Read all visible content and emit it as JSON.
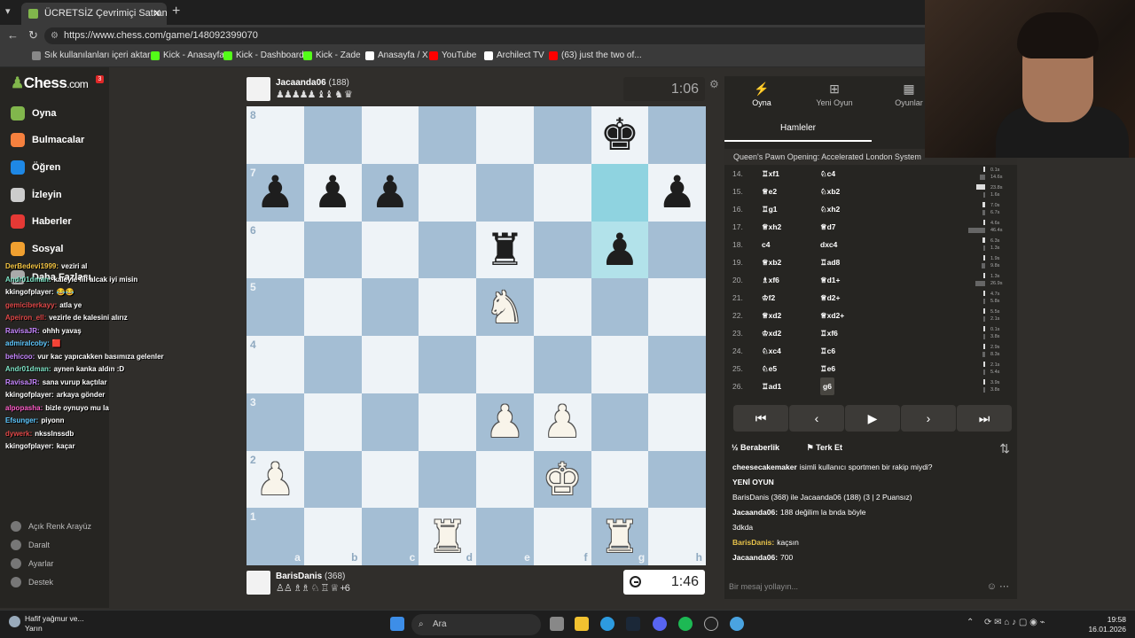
{
  "browser": {
    "tab_title": "ÜCRETSİZ Çevrimiçi Satranç Oyna",
    "url": "https://www.chess.com/game/148092399070",
    "bookmarks": [
      {
        "label": "Sık kullanılanları içeri aktar",
        "color": "#888888"
      },
      {
        "label": "Kick - Anasayfa",
        "color": "#53fc18"
      },
      {
        "label": "Kick - Dashboard",
        "color": "#53fc18"
      },
      {
        "label": "Kick - Zade",
        "color": "#53fc18"
      },
      {
        "label": "Anasayfa / X",
        "color": "#ffffff"
      },
      {
        "label": "YouTube",
        "color": "#ff0000"
      },
      {
        "label": "Archilect TV",
        "color": "#ffffff"
      },
      {
        "label": "(63) just the two of...",
        "color": "#ff0000"
      }
    ]
  },
  "sidebar": {
    "logo": "Chess",
    "logo_suffix": ".com",
    "badge": "3",
    "items": [
      {
        "label": "Oyna",
        "color": "#81b64c"
      },
      {
        "label": "Bulmacalar",
        "color": "#f5803e"
      },
      {
        "label": "Öğren",
        "color": "#1e88e5"
      },
      {
        "label": "İzleyin",
        "color": "#cccccc"
      },
      {
        "label": "Haberler",
        "color": "#e53935"
      },
      {
        "label": "Sosyal",
        "color": "#f0a030"
      },
      {
        "label": "Daha Fazlası",
        "color": "#aaaaaa"
      }
    ],
    "bottom": [
      "Açık Renk Arayüz",
      "Daralt",
      "Ayarlar",
      "Destek"
    ]
  },
  "stream_chat": [
    {
      "user": "DerBedevi1999:",
      "text": "veziri al",
      "color": "#f5c542"
    },
    {
      "user": "Andr01dman:",
      "text": "kaleyle fili alcak iyi misin",
      "color": "#7de3c5"
    },
    {
      "user": "kkingofplayer:",
      "text": "😂😂",
      "color": "#ffffff"
    },
    {
      "user": "gemiciberkayy:",
      "text": "atla ye",
      "color": "#e04848"
    },
    {
      "user": "Apeiron_ell:",
      "text": "vezirle de kalesini alırız",
      "color": "#e04848"
    },
    {
      "user": "RavisaJR:",
      "text": "ohhh yavaş",
      "color": "#c685ff"
    },
    {
      "user": "admiralcoby:",
      "text": "🟥",
      "color": "#5ec8ff"
    },
    {
      "user": "behicoo:",
      "text": "vur kac yapıcakken basımıza gelenler",
      "color": "#c685ff"
    },
    {
      "user": "Andr01dman:",
      "text": "aynen kanka aldın :D",
      "color": "#7de3c5"
    },
    {
      "user": "RavisaJR:",
      "text": "sana vurup kaçtılar",
      "color": "#c685ff"
    },
    {
      "user": "kkingofplayer:",
      "text": "arkaya gönder",
      "color": "#ffffff"
    },
    {
      "user": "alpopasha:",
      "text": "bizle oynuyo mu la",
      "color": "#ff5cc8"
    },
    {
      "user": "Efsunger:",
      "text": "piyonn",
      "color": "#5ec8ff"
    },
    {
      "user": "dywerk:",
      "text": "nkssInssdb",
      "color": "#e04848"
    },
    {
      "user": "kkingofplayer:",
      "text": "kaçar",
      "color": "#ffffff"
    }
  ],
  "top_player": {
    "name": "Jacaanda06",
    "rating": "(188)",
    "captures": "♟♟♟♟♟ ♝♝ ♞ ♛",
    "clock": "1:06"
  },
  "bottom_player": {
    "name": "BarisDanis",
    "rating": "(368)",
    "captures": "♙♙ ♗♗ ♘ ♖ ♕",
    "advantage": "+6",
    "clock": "1:46"
  },
  "board": {
    "files": [
      "a",
      "b",
      "c",
      "d",
      "e",
      "f",
      "g",
      "h"
    ],
    "ranks": [
      "8",
      "7",
      "6",
      "5",
      "4",
      "3",
      "2",
      "1"
    ],
    "pieces": [
      {
        "sq": "g8",
        "p": "♚",
        "side": "b"
      },
      {
        "sq": "a7",
        "p": "♟",
        "side": "b"
      },
      {
        "sq": "b7",
        "p": "♟",
        "side": "b"
      },
      {
        "sq": "c7",
        "p": "♟",
        "side": "b"
      },
      {
        "sq": "h7",
        "p": "♟",
        "side": "b"
      },
      {
        "sq": "e6",
        "p": "♜",
        "side": "b"
      },
      {
        "sq": "g6",
        "p": "♟",
        "side": "b"
      },
      {
        "sq": "e5",
        "p": "♞",
        "side": "w"
      },
      {
        "sq": "e3",
        "p": "♟",
        "side": "w"
      },
      {
        "sq": "f3",
        "p": "♟",
        "side": "w"
      },
      {
        "sq": "a2",
        "p": "♟",
        "side": "w"
      },
      {
        "sq": "f2",
        "p": "♚",
        "side": "w"
      },
      {
        "sq": "d1",
        "p": "♜",
        "side": "w"
      },
      {
        "sq": "g1",
        "p": "♜",
        "side": "w"
      }
    ],
    "highlight_from": "g7",
    "highlight_to": "g6"
  },
  "panel": {
    "tabs": [
      {
        "label": "Oyna",
        "icon": "⚡"
      },
      {
        "label": "Yeni Oyun",
        "icon": "⊞"
      },
      {
        "label": "Oyunlar",
        "icon": "▦"
      }
    ],
    "subtab": "Hamleler",
    "opening": "Queen's Pawn Opening: Accelerated London System",
    "moves": [
      {
        "n": "14.",
        "w": "♖xf1",
        "b": "♘c4",
        "tw": "0.1s",
        "tb": "14.6s",
        "fw": 0.02,
        "fb": 0.3
      },
      {
        "n": "15.",
        "w": "♕e2",
        "b": "♘xb2",
        "tw": "23.8s",
        "tb": "1.6s",
        "fw": 0.5,
        "fb": 0.04
      },
      {
        "n": "16.",
        "w": "♖g1",
        "b": "♘xh2",
        "tw": "7.0s",
        "tb": "6.7s",
        "fw": 0.15,
        "fb": 0.14
      },
      {
        "n": "17.",
        "w": "♕xh2",
        "b": "♕d7",
        "tw": "4.6s",
        "tb": "46.4s",
        "fw": 0.1,
        "fb": 0.95
      },
      {
        "n": "18.",
        "w": "c4",
        "b": "dxc4",
        "tw": "6.3s",
        "tb": "1.3s",
        "fw": 0.13,
        "fb": 0.03
      },
      {
        "n": "19.",
        "w": "♕xb2",
        "b": "♖ad8",
        "tw": "1.9s",
        "tb": "9.8s",
        "fw": 0.04,
        "fb": 0.2
      },
      {
        "n": "20.",
        "w": "♗xf6",
        "b": "♕d1+",
        "tw": "1.3s",
        "tb": "26.9s",
        "fw": 0.03,
        "fb": 0.55
      },
      {
        "n": "21.",
        "w": "♔f2",
        "b": "♕d2+",
        "tw": "4.7s",
        "tb": "5.8s",
        "fw": 0.1,
        "fb": 0.12
      },
      {
        "n": "22.",
        "w": "♕xd2",
        "b": "♕xd2+",
        "tw": "5.5s",
        "tb": "2.1s",
        "fw": 0.11,
        "fb": 0.04
      },
      {
        "n": "23.",
        "w": "♔xd2",
        "b": "♖xf6",
        "tw": "0.1s",
        "tb": "3.8s",
        "fw": 0.02,
        "fb": 0.08
      },
      {
        "n": "24.",
        "w": "♘xc4",
        "b": "♖c6",
        "tw": "2.9s",
        "tb": "8.3s",
        "fw": 0.06,
        "fb": 0.17
      },
      {
        "n": "25.",
        "w": "♘e5",
        "b": "♖e6",
        "tw": "2.1s",
        "tb": "5.4s",
        "fw": 0.04,
        "fb": 0.11
      },
      {
        "n": "26.",
        "w": "♖ad1",
        "b": "g6",
        "tw": "3.9s",
        "tb": "3.8s",
        "fw": 0.08,
        "fb": 0.08
      }
    ],
    "controls": [
      "⏮",
      "‹",
      "▶",
      "›",
      "⏭"
    ],
    "draw_label": "Beraberlik",
    "resign_label": "Terk Et",
    "chat": [
      {
        "user": "cheesecakemaker",
        "text": "isimli kullanıcı sportmen bir rakip miydi?"
      },
      {
        "user": "",
        "text": "YENİ OYUN"
      },
      {
        "user": "",
        "text": "BarisDanis (368) ile Jacaanda06 (188) (3 | 2 Puansız)"
      },
      {
        "user": "Jacaanda06:",
        "text": "188 değilim la bnda böyle"
      },
      {
        "user": "",
        "text": "3dkda"
      },
      {
        "user": "BarisDanis:",
        "text": "kaçsın"
      },
      {
        "user": "Jacaanda06:",
        "text": "700"
      }
    ],
    "msg_placeholder": "Bir mesaj yollayın..."
  },
  "taskbar": {
    "weather_title": "Hafif yağmur ve...",
    "weather_sub": "Yarın",
    "search": "Ara",
    "time": "19:58",
    "date": "16.01.2026"
  }
}
